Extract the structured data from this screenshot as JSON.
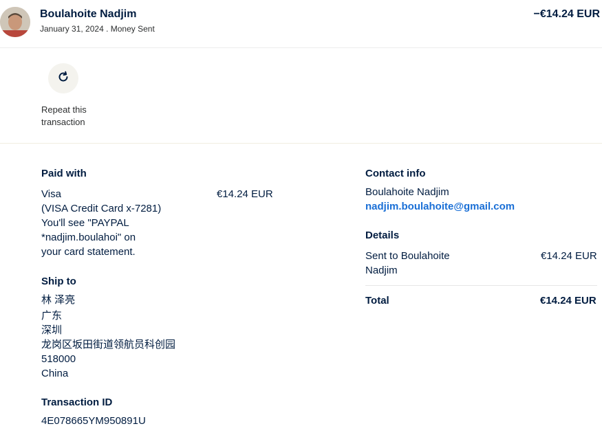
{
  "header": {
    "name": "Boulahoite Nadjim",
    "date": "January 31, 2024",
    "separator": " . ",
    "type": "Money Sent",
    "amount": "−€14.24 EUR"
  },
  "actions": {
    "repeat_label": "Repeat this transaction",
    "repeat_icon": "refresh-icon"
  },
  "paid_with": {
    "title": "Paid with",
    "lines": [
      "Visa",
      "(VISA Credit Card x-7281)",
      "You'll see \"PAYPAL",
      "*nadjim.boulahoi\" on",
      "your card statement."
    ],
    "amount": "€14.24 EUR"
  },
  "ship_to": {
    "title": "Ship to",
    "lines": [
      "林 泽亮",
      "广东",
      "深圳",
      "龙岗区坂田街道领航员科创园",
      "518000",
      "China"
    ]
  },
  "transaction": {
    "title": "Transaction ID",
    "id": "4E078665YM950891U"
  },
  "contact": {
    "title": "Contact info",
    "name": "Boulahoite Nadjim",
    "email": "nadjim.boulahoite@gmail.com"
  },
  "details": {
    "title": "Details",
    "sent_to_lines": [
      "Sent to Boulahoite",
      "Nadjim"
    ],
    "sent_amount": "€14.24 EUR",
    "total_label": "Total",
    "total_amount": "€14.24 EUR"
  }
}
